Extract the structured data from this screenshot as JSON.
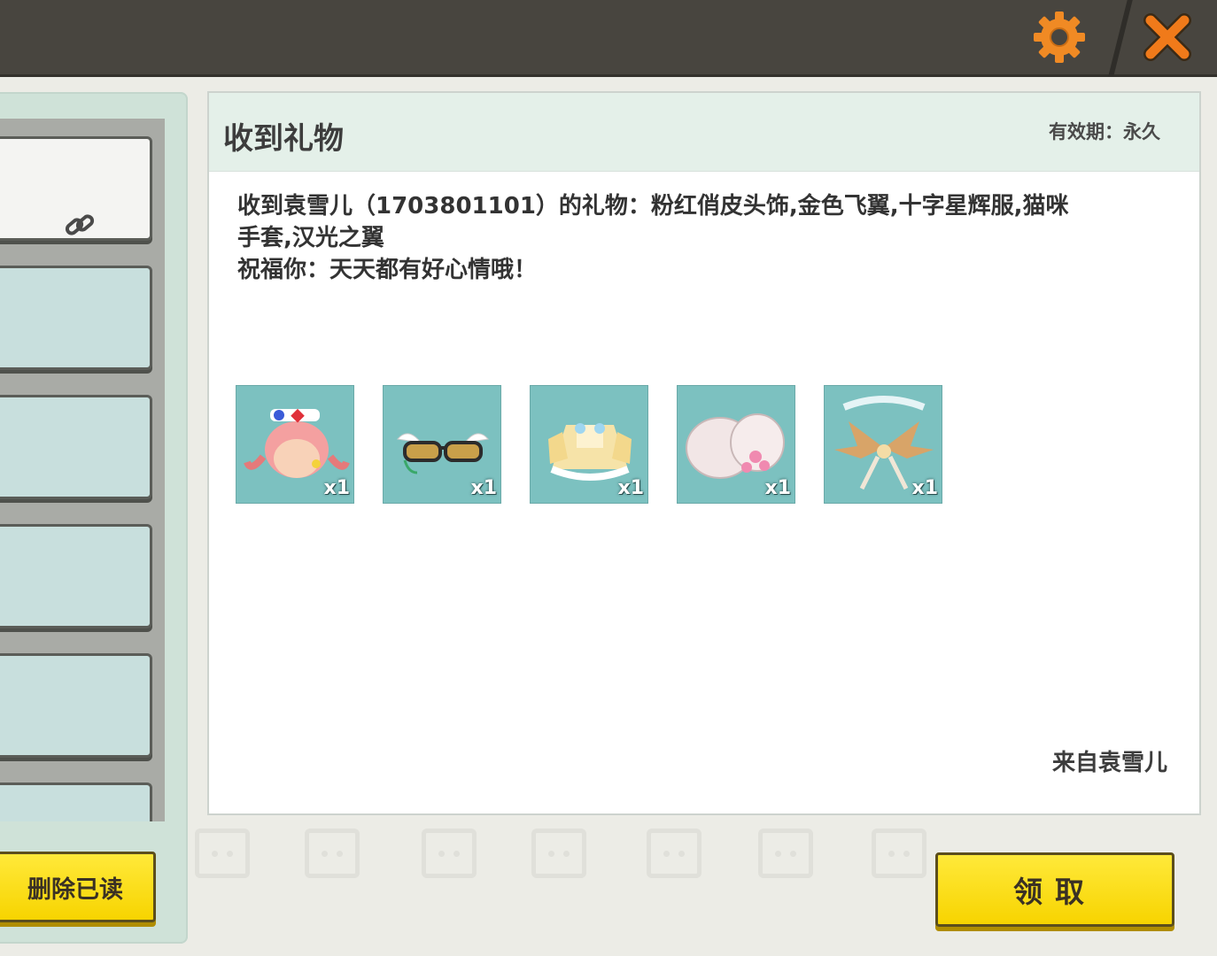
{
  "topbar": {
    "icons": [
      "gear-icon",
      "close-icon"
    ]
  },
  "left_panel": {
    "delete_read_label": "删除已读",
    "mail_count_visible": 6
  },
  "mail": {
    "title": "收到礼物",
    "validity_label": "有效期：",
    "validity_value": "永久",
    "body_line1": "收到袁雪儿（1703801101）的礼物：粉红俏皮头饰,金色飞翼,十字星辉服,猫咪",
    "body_line2": "手套,汉光之翼",
    "body_line3": "祝福你：天天都有好心情哦！",
    "items": [
      {
        "name": "粉红俏皮头饰",
        "qty": "x1"
      },
      {
        "name": "金色飞翼",
        "qty": "x1"
      },
      {
        "name": "十字星辉服",
        "qty": "x1"
      },
      {
        "name": "猫咪手套",
        "qty": "x1"
      },
      {
        "name": "汉光之翼",
        "qty": "x1"
      }
    ],
    "sender": "来自袁雪儿",
    "claim_label": "领取"
  },
  "colors": {
    "accent_orange": "#f08a24",
    "button_yellow": "#f7d400",
    "topbar": "#48453f",
    "item_bg": "#7cc1c0"
  }
}
